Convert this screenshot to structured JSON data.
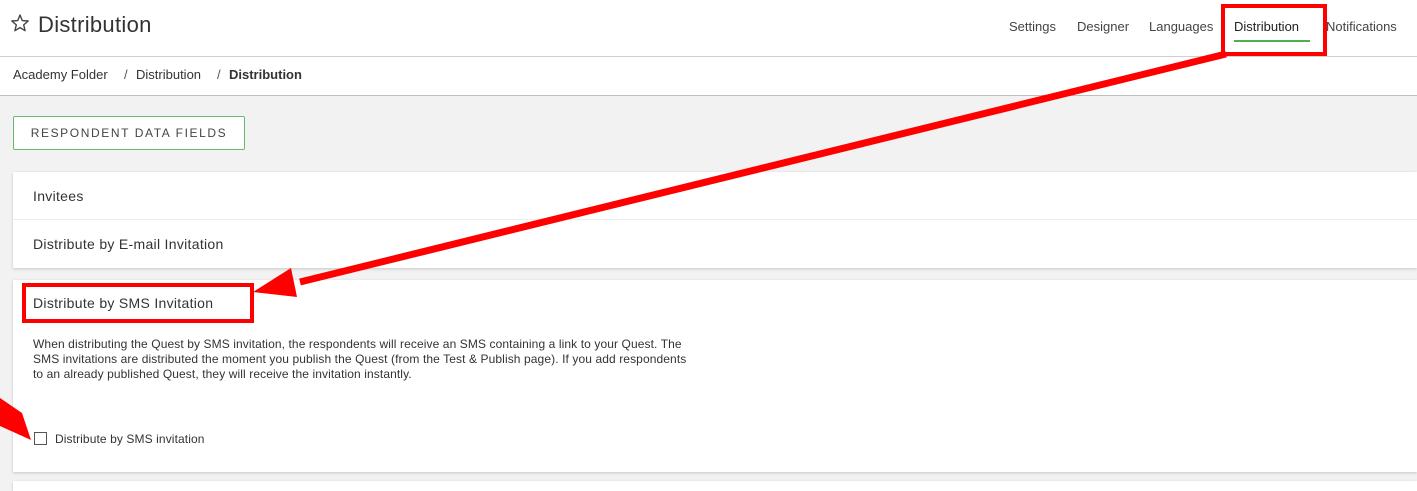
{
  "header": {
    "title": "Distribution",
    "star_icon": "star-outline-icon",
    "nav": [
      {
        "label": "Settings"
      },
      {
        "label": "Designer"
      },
      {
        "label": "Languages"
      },
      {
        "label": "Distribution",
        "active": true
      },
      {
        "label": "Notifications"
      }
    ]
  },
  "breadcrumb": {
    "items": [
      "Academy Folder",
      "Distribution",
      "Distribution"
    ],
    "separator": "/"
  },
  "toolbar": {
    "respondent_fields_label": "RESPONDENT DATA FIELDS"
  },
  "panels": {
    "invitees": "Invitees",
    "email": "Distribute by E-mail Invitation",
    "sms": {
      "title": "Distribute by SMS Invitation",
      "description": "When distributing the Quest by SMS invitation, the respondents will receive an SMS containing a link to your Quest. The SMS invitations are distributed the moment you publish the Quest (from the Test & Publish page). If you add respondents to an already published Quest, they will receive the invitation instantly.",
      "checkbox_label": "Distribute by SMS invitation",
      "checkbox_checked": false
    }
  },
  "colors": {
    "accent_green": "#4caf50",
    "annotation_red": "#ff0000"
  }
}
